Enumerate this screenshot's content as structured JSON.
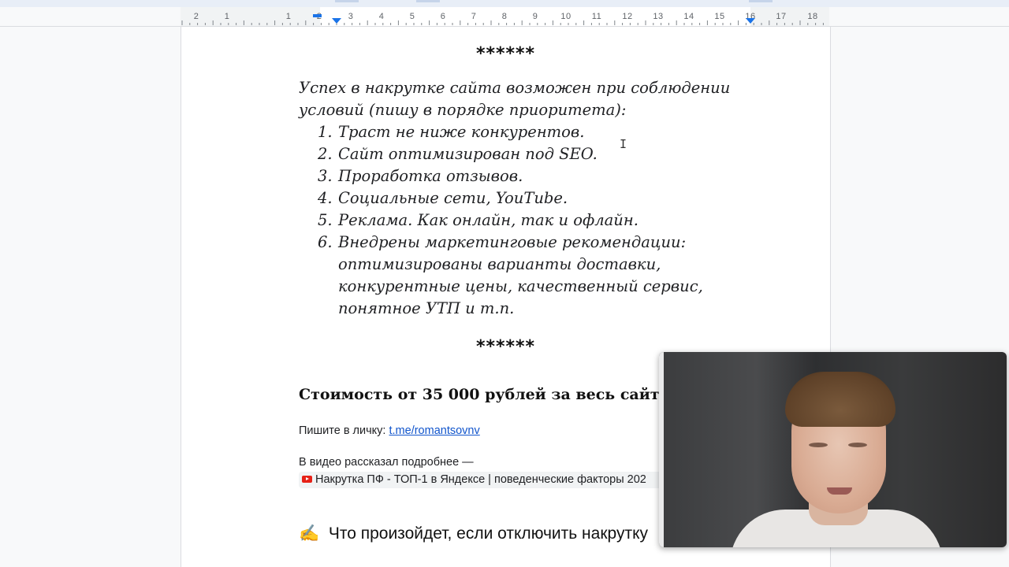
{
  "ruler": {
    "numbers": [
      "2",
      "1",
      "1",
      "2",
      "3",
      "4",
      "5",
      "6",
      "7",
      "8",
      "9",
      "10",
      "11",
      "12",
      "13",
      "14",
      "15",
      "16",
      "17",
      "18"
    ]
  },
  "document": {
    "stars_top": "******",
    "intro": "Успех в накрутке сайта возможен при соблюдении условий (пишу в порядке приоритета):",
    "conditions": [
      {
        "num": "1.",
        "text": "Траст не ниже конкурентов."
      },
      {
        "num": "2.",
        "text": "Сайт оптимизирован под SEO."
      },
      {
        "num": "3.",
        "text": "Проработка отзывов."
      },
      {
        "num": "4.",
        "text": "Социальные сети, YouTube."
      },
      {
        "num": "5.",
        "text": "Реклама. Как онлайн, так и офлайн."
      },
      {
        "num": "6.",
        "text": "Внедрены маркетинговые рекомендации: оптимизированы варианты доставки, конкурентные цены, качественный сервис, понятное УТП и т.п."
      }
    ],
    "stars_bottom": "******",
    "price": "Стоимость от 35 000 рублей за весь сайт.",
    "contact_prefix": "Пишите в личку: ",
    "contact_link": "t.me/romantsovnv",
    "video_note": "В видео рассказал подробнее —",
    "video_chip": "Накрутка ПФ - ТОП-1 в Яндексе | поведенческие факторы 202",
    "next_heading_emoji": "✍",
    "next_heading": "Что произойдет, если отключить накрутку"
  },
  "video_overlay": {
    "icon": "webcam-person"
  },
  "colors": {
    "link": "#1155cc",
    "youtube": "#e62117",
    "ruler_marker": "#1a73e8"
  }
}
